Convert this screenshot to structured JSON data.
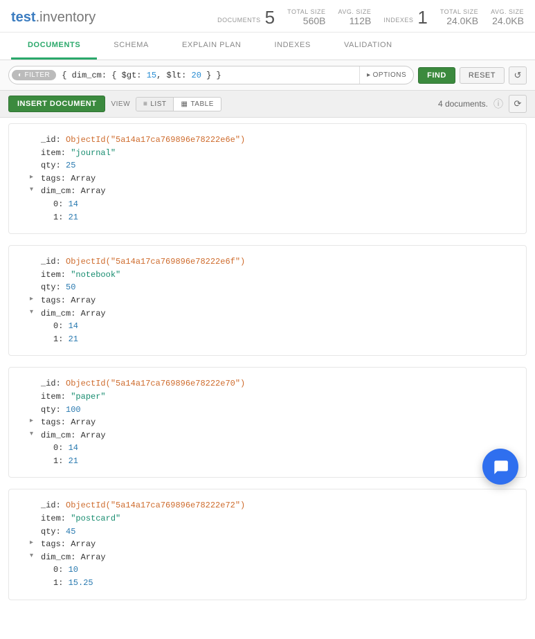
{
  "header": {
    "db": "test",
    "sep": ".",
    "coll": "inventory",
    "stats": {
      "documents_label": "DOCUMENTS",
      "documents": "5",
      "doc_total_size_label": "TOTAL SIZE",
      "doc_total_size": "560B",
      "doc_avg_size_label": "AVG. SIZE",
      "doc_avg_size": "112B",
      "indexes_label": "INDEXES",
      "indexes": "1",
      "idx_total_size_label": "TOTAL SIZE",
      "idx_total_size": "24.0KB",
      "idx_avg_size_label": "AVG. SIZE",
      "idx_avg_size": "24.0KB"
    }
  },
  "tabs": {
    "documents": "DOCUMENTS",
    "schema": "SCHEMA",
    "explain": "EXPLAIN PLAN",
    "indexes": "INDEXES",
    "validation": "VALIDATION"
  },
  "query": {
    "filter_chip": "FILTER",
    "pre": "{ dim_cm: { $gt: ",
    "n1": "15",
    "mid": ", $lt: ",
    "n2": "20",
    "post": " } }",
    "options": "OPTIONS",
    "find": "FIND",
    "reset": "RESET"
  },
  "toolbar": {
    "insert": "INSERT DOCUMENT",
    "view": "VIEW",
    "list": "LIST",
    "table": "TABLE",
    "count": "4 documents."
  },
  "field_labels": {
    "id": "_id",
    "item": "item",
    "qty": "qty",
    "tags": "tags",
    "dim_cm": "dim_cm",
    "i0": "0",
    "i1": "1",
    "array": "Array"
  },
  "docs": [
    {
      "_id": "ObjectId(\"5a14a17ca769896e78222e6e\")",
      "item": "\"journal\"",
      "qty": "25",
      "dim0": "14",
      "dim1": "21"
    },
    {
      "_id": "ObjectId(\"5a14a17ca769896e78222e6f\")",
      "item": "\"notebook\"",
      "qty": "50",
      "dim0": "14",
      "dim1": "21"
    },
    {
      "_id": "ObjectId(\"5a14a17ca769896e78222e70\")",
      "item": "\"paper\"",
      "qty": "100",
      "dim0": "14",
      "dim1": "21"
    },
    {
      "_id": "ObjectId(\"5a14a17ca769896e78222e72\")",
      "item": "\"postcard\"",
      "qty": "45",
      "dim0": "10",
      "dim1": "15.25"
    }
  ]
}
